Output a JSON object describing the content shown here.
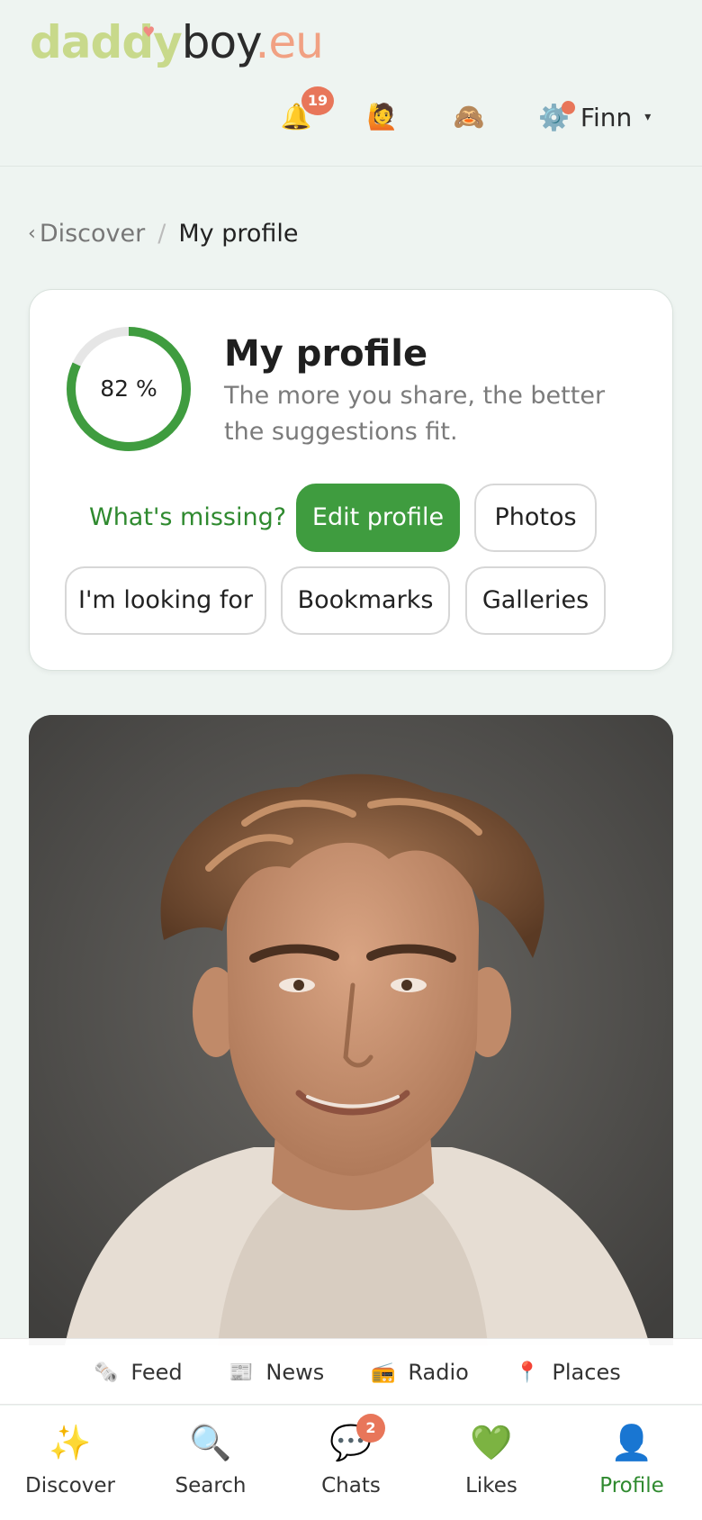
{
  "header": {
    "logo": {
      "part1": "daddy",
      "part2": "boy",
      "part3": ".eu"
    },
    "notifications": {
      "icon": "bell-icon",
      "glyph": "🔔",
      "count": "19"
    },
    "visitors": {
      "icon": "person-raising-hand-icon",
      "glyph": "🙋"
    },
    "privacy": {
      "icon": "see-no-evil-monkey-icon",
      "glyph": "🙈"
    },
    "user": {
      "icon": "gear-icon",
      "glyph": "⚙️",
      "name": "Finn",
      "caret": "▾"
    }
  },
  "breadcrumb": {
    "back_chevron": "‹",
    "parent": "Discover",
    "separator": "/",
    "current": "My profile"
  },
  "profile_card": {
    "completion_percent": 82,
    "completion_label": "82 %",
    "title": "My profile",
    "subtitle": "The more you share, the better the suggestions fit.",
    "missing_link": "What's missing?",
    "buttons": {
      "edit": "Edit profile",
      "photos": "Photos",
      "looking_for": "I'm looking for",
      "bookmarks": "Bookmarks",
      "galleries": "Galleries"
    }
  },
  "sub_nav": [
    {
      "icon": "newspaper-roll-icon",
      "glyph": "🗞️",
      "label": "Feed"
    },
    {
      "icon": "newspaper-icon",
      "glyph": "📰",
      "label": "News"
    },
    {
      "icon": "radio-icon",
      "glyph": "📻",
      "label": "Radio"
    },
    {
      "icon": "pin-icon",
      "glyph": "📍",
      "label": "Places"
    }
  ],
  "tab_bar": [
    {
      "icon": "sparkles-icon",
      "glyph": "✨",
      "label": "Discover"
    },
    {
      "icon": "magnifier-icon",
      "glyph": "🔍",
      "label": "Search"
    },
    {
      "icon": "speech-bubble-icon",
      "glyph": "💬",
      "label": "Chats",
      "badge": "2"
    },
    {
      "icon": "green-heart-icon",
      "glyph": "💚",
      "label": "Likes"
    },
    {
      "icon": "person-silhouette-icon",
      "glyph": "👤",
      "label": "Profile",
      "active": true
    }
  ],
  "colors": {
    "accent": "#3f9c3f",
    "badge": "#e8765a",
    "background": "#eef4f1"
  }
}
